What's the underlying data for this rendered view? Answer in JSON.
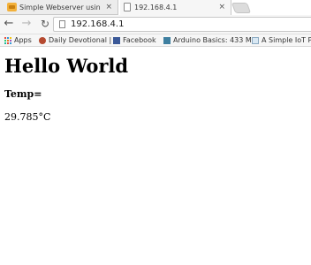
{
  "browser": {
    "tabs": [
      {
        "title": "Simple Webserver using A",
        "close": "×",
        "active": false
      },
      {
        "title": "192.168.4.1",
        "close": "×",
        "active": true
      }
    ],
    "nav": {
      "back": "←",
      "forward": "→",
      "reload": "↻"
    },
    "url": "192.168.4.1",
    "bookmarks": [
      {
        "label": "Apps",
        "icon": "apps-grid-icon"
      },
      {
        "label": "Daily Devotional |",
        "icon": "devotional-icon"
      },
      {
        "label": "Facebook",
        "icon": "facebook-icon"
      },
      {
        "label": "Arduino Basics: 433 M",
        "icon": "arduino-icon"
      },
      {
        "label": "A Simple IoT Pr",
        "icon": "iot-icon"
      }
    ]
  },
  "page": {
    "heading": "Hello World",
    "temp_label": "Temp=",
    "temp_value": "29.785°C"
  },
  "colors": {
    "toolbar_bg": "#f6f6f6",
    "facebook_blue": "#3b5998",
    "tab_favicon": "#f3b13b"
  }
}
